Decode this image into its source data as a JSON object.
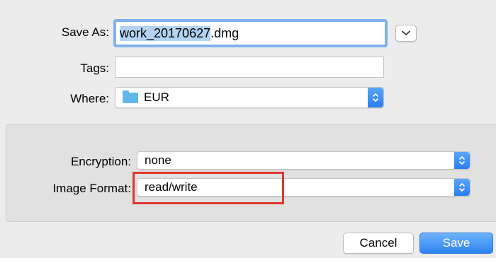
{
  "save_as": {
    "label": "Save As:",
    "value_selected": "work_20170627",
    "value_suffix": ".dmg"
  },
  "tags": {
    "label": "Tags:",
    "value": ""
  },
  "where": {
    "label": "Where:",
    "value": "EUR"
  },
  "encryption": {
    "label": "Encryption:",
    "value": "none"
  },
  "image_format": {
    "label": "Image Format:",
    "value": "read/write"
  },
  "buttons": {
    "cancel": "Cancel",
    "save": "Save"
  },
  "colors": {
    "accent": "#2f83f3",
    "selection": "#b3d3f5",
    "focus_ring": "#7fb2ee",
    "highlight_box": "#e0372c",
    "folder": "#61b8ea"
  }
}
